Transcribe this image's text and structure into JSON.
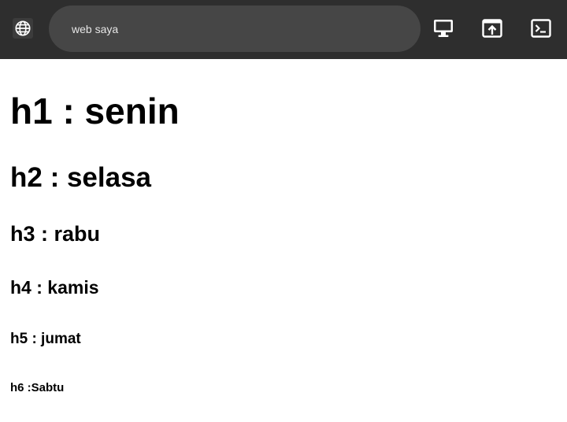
{
  "browser": {
    "url_text": "web saya",
    "icons": {
      "site": "globe-icon",
      "display": "monitor-icon",
      "open_external": "open-in-new-window-icon",
      "console": "terminal-icon"
    },
    "colors": {
      "toolbar": "#2e2e2e",
      "urlbar": "#464646",
      "url_text": "#e6e6e6"
    }
  },
  "page": {
    "headings": {
      "h1": "h1 : senin",
      "h2": "h2 : selasa",
      "h3": "h3 : rabu",
      "h4": "h4 : kamis",
      "h5": "h5 : jumat",
      "h6": "h6 :Sabtu"
    },
    "background": "#ffffff"
  }
}
